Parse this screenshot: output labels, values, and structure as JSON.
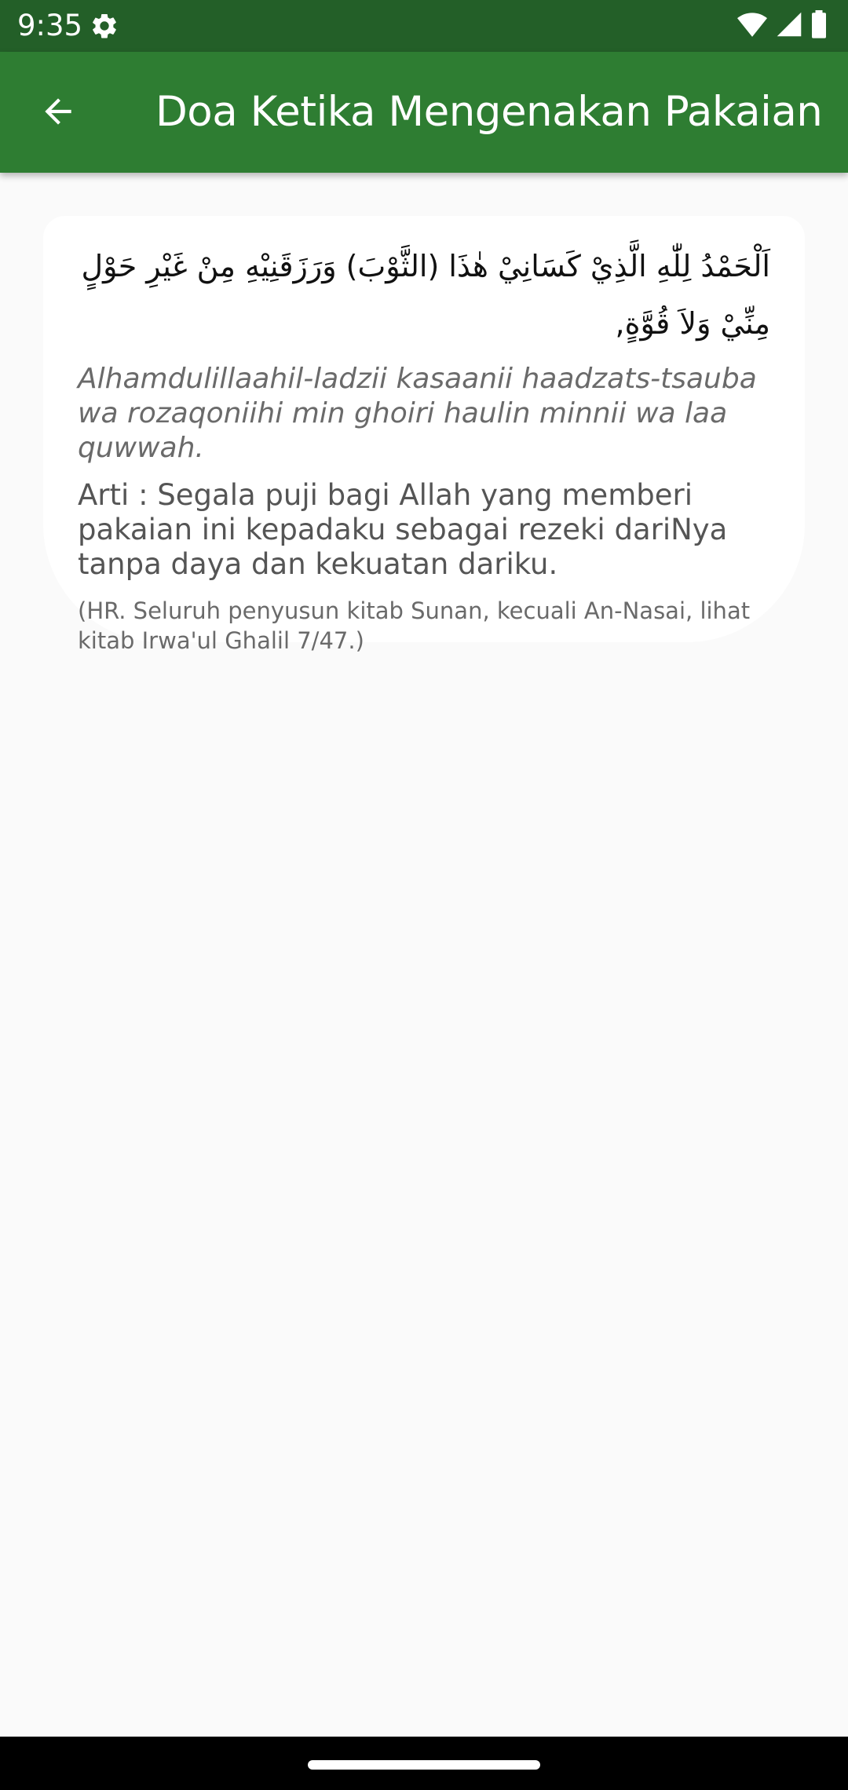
{
  "status_bar": {
    "time": "9:35",
    "icons": [
      "gear-icon",
      "wifi-icon",
      "signal-icon",
      "battery-icon"
    ]
  },
  "app_bar": {
    "title": "Doa Ketika Mengenakan Pakaian",
    "back_icon": "arrow-left-icon",
    "background_color": "#2e7d32"
  },
  "doa": {
    "arabic": "اَلْحَمْدُ لِلّٰهِ الَّذِيْ كَسَانِيْ هٰذَا (الثَّوْبَ) وَرَزَقَنِيْهِ مِنْ غَيْرِ حَوْلٍ مِنِّيْ وَلاَ قُوَّةٍ,",
    "latin": "Alhamdulillaahil-ladzii kasaanii haadzats-tsauba wa rozaqoniihi min ghoiri haulin minnii wa laa quwwah.",
    "meaning": "Arti : Segala puji bagi Allah yang memberi pakaian ini kepadaku sebagai rezeki dariNya tanpa daya dan kekuatan dariku.",
    "source": "(HR. Seluruh penyusun kitab Sunan, kecuali An-Nasai, lihat kitab Irwa'ul Ghalil 7/47.)"
  },
  "colors": {
    "status_bar": "#235f28",
    "app_bar": "#2e7d32",
    "background": "#fafafa",
    "card": "#ffffff"
  }
}
